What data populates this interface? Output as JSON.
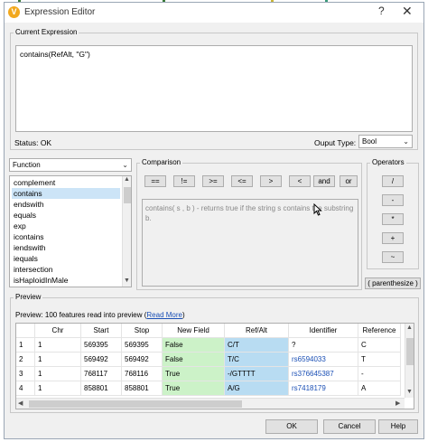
{
  "window": {
    "title": "Expression Editor",
    "help_glyph": "?",
    "close_glyph": "✕",
    "icon_letter": "V"
  },
  "current_expression": {
    "label": "Current Expression",
    "value": "contains(RefAlt, \"G\")"
  },
  "status": {
    "text": "Status: OK"
  },
  "output_type": {
    "label": "Ouput Type:",
    "value": "Bool"
  },
  "function_list": {
    "category": "Function",
    "items": [
      "complement",
      "contains",
      "endswith",
      "equals",
      "exp",
      "icontains",
      "iendswith",
      "iequals",
      "intersection",
      "isHaploidInMale"
    ],
    "selected_index": 1
  },
  "comparison": {
    "label": "Comparison",
    "buttons": [
      "==",
      "!=",
      ">=",
      "<=",
      ">",
      "<",
      "and",
      "or"
    ],
    "help_text": "contains( s , b ) - returns true if the string s contains the substring b."
  },
  "operators": {
    "label": "Operators",
    "buttons": [
      "/",
      "-",
      "*",
      "+",
      "~"
    ],
    "parenthesize": "( parenthesize )"
  },
  "preview": {
    "label": "Preview",
    "summary_text": "Preview: 100 features read into preview (",
    "read_more": "Read More",
    "summary_close": ")",
    "columns": [
      "",
      "Chr",
      "Start",
      "Stop",
      "New Field",
      "Ref/Alt",
      "Identifier",
      "Reference"
    ],
    "rows": [
      [
        "1",
        "1",
        "569395",
        "569395",
        "False",
        "C/T",
        "?",
        "C"
      ],
      [
        "2",
        "1",
        "569492",
        "569492",
        "False",
        "T/C",
        "rs6594033",
        "T"
      ],
      [
        "3",
        "1",
        "768117",
        "768116",
        "True",
        "-/GTTTT",
        "rs376645387",
        "-"
      ],
      [
        "4",
        "1",
        "858801",
        "858801",
        "True",
        "A/G",
        "rs7418179",
        "A"
      ]
    ]
  },
  "footer": {
    "ok": "OK",
    "cancel": "Cancel",
    "help": "Help"
  },
  "colors": {
    "true_false_cell": "#ccf2c8",
    "refalt_cell": "#b8dcf2",
    "accent": "#f2a81d"
  }
}
